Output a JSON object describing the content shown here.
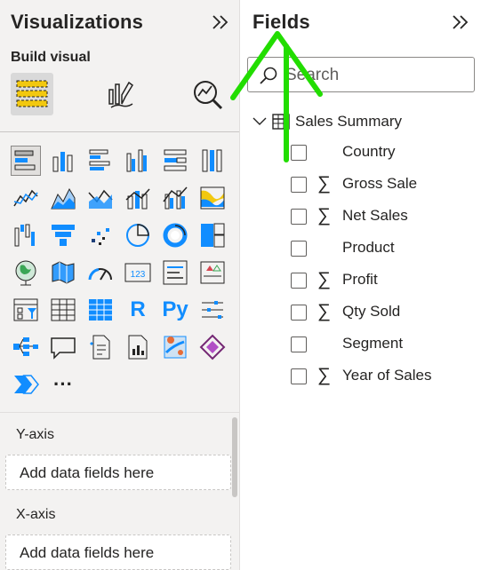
{
  "visualizations": {
    "title": "Visualizations",
    "build_visual_label": "Build visual",
    "mode_buttons": [
      "build-visual-icon",
      "format-visual-icon",
      "analytics-icon"
    ],
    "icons": [
      [
        "stacked-bar-chart-icon",
        "stacked-column-chart-icon",
        "clustered-bar-chart-icon",
        "clustered-column-chart-icon",
        "100-stacked-bar-chart-icon",
        "100-stacked-column-chart-icon"
      ],
      [
        "line-chart-icon",
        "area-chart-icon",
        "stacked-area-chart-icon",
        "line-and-stacked-column-chart-icon",
        "line-and-clustered-column-chart-icon",
        "ribbon-chart-icon"
      ],
      [
        "waterfall-chart-icon",
        "funnel-icon",
        "scatter-chart-icon",
        "pie-chart-icon",
        "donut-chart-icon",
        "treemap-icon"
      ],
      [
        "map-icon",
        "filled-map-icon",
        "gauge-icon",
        "card-icon",
        "multi-row-card-icon",
        "kpi-icon"
      ],
      [
        "slicer-icon",
        "table-icon",
        "matrix-icon",
        "r-script-visual-icon",
        "python-visual-icon",
        "key-influencers-icon"
      ],
      [
        "decomposition-tree-icon",
        "qa-icon",
        "smart-narrative-icon",
        "paginated-report-icon",
        "azure-map-icon",
        "power-apps-icon"
      ],
      [
        "power-automate-icon",
        "more-visuals-icon"
      ]
    ],
    "r_label": "R",
    "py_label": "Py",
    "card_value": "123",
    "more_label": "···",
    "wells": [
      {
        "label": "Y-axis",
        "placeholder": "Add data fields here"
      },
      {
        "label": "X-axis",
        "placeholder": "Add data fields here"
      }
    ]
  },
  "fields": {
    "title": "Fields",
    "search_placeholder": "Search",
    "table_name": "Sales Summary",
    "items": [
      {
        "name": "Country",
        "sigma": ""
      },
      {
        "name": "Gross Sale",
        "sigma": "∑"
      },
      {
        "name": "Net Sales",
        "sigma": "∑"
      },
      {
        "name": "Product",
        "sigma": ""
      },
      {
        "name": "Profit",
        "sigma": "∑"
      },
      {
        "name": "Qty Sold",
        "sigma": "∑"
      },
      {
        "name": "Segment",
        "sigma": ""
      },
      {
        "name": "Year of Sales",
        "sigma": "∑"
      }
    ]
  },
  "colors": {
    "accent_blue": "#118dff",
    "accent_yellow": "#f2c80f",
    "annotation_green": "#22dd00"
  }
}
